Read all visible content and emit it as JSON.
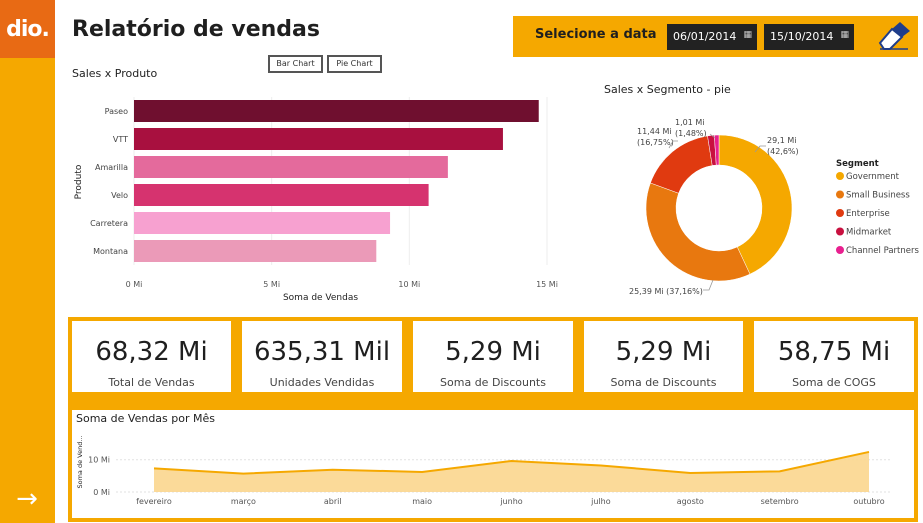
{
  "logo": {
    "text": "dio."
  },
  "header": {
    "title": "Relatório de vendas"
  },
  "date_filter": {
    "label": "Selecione a data",
    "start": "06/01/2014",
    "end": "15/10/2014"
  },
  "toggles": {
    "bar": "Bar Chart",
    "pie": "Pie Chart"
  },
  "colors": {
    "accent": "#f5a800",
    "logo_bg": "#e86a14"
  },
  "kpis": [
    {
      "value": "68,32 Mi",
      "label": "Total de Vendas"
    },
    {
      "value": "635,31 Mil",
      "label": "Unidades Vendidas"
    },
    {
      "value": "5,29 Mi",
      "label": "Soma de Discounts"
    },
    {
      "value": "5,29 Mi",
      "label": "Soma de Discounts"
    },
    {
      "value": "58,75 Mi",
      "label": "Soma de COGS"
    }
  ],
  "chart_data": [
    {
      "type": "bar",
      "orientation": "horizontal",
      "title": "Sales x Produto",
      "xlabel": "Soma de Vendas",
      "ylabel": "Produto",
      "categories": [
        "Paseo",
        "VTT",
        "Amarilla",
        "Velo",
        "Carretera",
        "Montana"
      ],
      "values": [
        14.7,
        13.4,
        11.4,
        10.7,
        9.3,
        8.8
      ],
      "colors": [
        "#6f0f2f",
        "#a8103f",
        "#e46a9c",
        "#d6336f",
        "#f7a1d0",
        "#eb9ab8"
      ],
      "xlim": [
        0,
        15
      ],
      "xticks": [
        0,
        5,
        10,
        15
      ],
      "xtick_labels": [
        "0 Mi",
        "5 Mi",
        "10 Mi",
        "15 Mi"
      ]
    },
    {
      "type": "pie",
      "style": "donut",
      "title": "Sales x Segmento - pie",
      "legend_title": "Segment",
      "legend_position": "right",
      "slices": [
        {
          "name": "Government",
          "value": 29.1,
          "label": "29,1 Mi",
          "pct": "(42,6%)",
          "color": "#f5a800"
        },
        {
          "name": "Small Business",
          "value": 25.39,
          "label": "25,39 Mi (37,16%)",
          "pct": "",
          "color": "#e8780f"
        },
        {
          "name": "Enterprise",
          "value": 11.44,
          "label": "11,44 Mi",
          "pct": "(16,75%)",
          "color": "#e03a10"
        },
        {
          "name": "Midmarket",
          "value": 1.01,
          "label": "1,01 Mi",
          "pct": "(1,48%)",
          "color": "#c8103f"
        },
        {
          "name": "Channel Partners",
          "value": 0.69,
          "label": "",
          "pct": "",
          "color": "#e8208f"
        }
      ]
    },
    {
      "type": "area",
      "title": "Soma de Vendas por Mês",
      "ylabel": "Soma de Vend...",
      "categories": [
        "fevereiro",
        "março",
        "abril",
        "maio",
        "junho",
        "julho",
        "agosto",
        "setembro",
        "outubro"
      ],
      "values": [
        7.3,
        5.7,
        6.9,
        6.2,
        9.6,
        8.2,
        5.9,
        6.4,
        12.4
      ],
      "ylim": [
        0,
        13
      ],
      "yticks": [
        0,
        10
      ],
      "ytick_labels": [
        "0 Mi",
        "10 Mi"
      ],
      "color": "#f5a800"
    }
  ]
}
